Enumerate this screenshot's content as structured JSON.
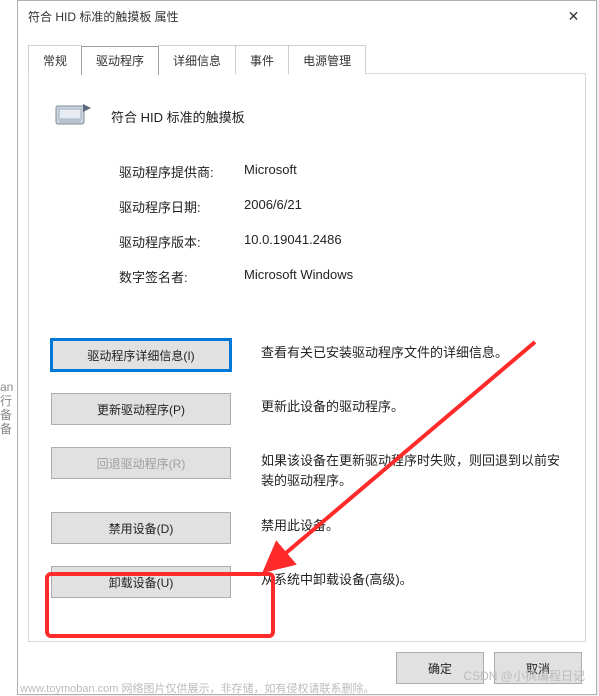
{
  "dialog": {
    "title": "符合 HID 标准的触摸板 属性",
    "close_glyph": "✕"
  },
  "tabs": [
    "常规",
    "驱动程序",
    "详细信息",
    "事件",
    "电源管理"
  ],
  "active_tab_index": 1,
  "device_title": "符合 HID 标准的触摸板",
  "info": {
    "provider_label": "驱动程序提供商:",
    "provider_value": "Microsoft",
    "date_label": "驱动程序日期:",
    "date_value": "2006/6/21",
    "version_label": "驱动程序版本:",
    "version_value": "10.0.19041.2486",
    "signer_label": "数字签名者:",
    "signer_value": "Microsoft Windows"
  },
  "actions": {
    "details_btn": "驱动程序详细信息(I)",
    "details_desc": "查看有关已安装驱动程序文件的详细信息。",
    "update_btn": "更新驱动程序(P)",
    "update_desc": "更新此设备的驱动程序。",
    "rollback_btn": "回退驱动程序(R)",
    "rollback_desc": "如果该设备在更新驱动程序时失败，则回退到以前安装的驱动程序。",
    "disable_btn": "禁用设备(D)",
    "disable_desc": "禁用此设备。",
    "uninstall_btn": "卸载设备(U)",
    "uninstall_desc": "从系统中卸载设备(高级)。"
  },
  "dialog_buttons": {
    "ok": "确定",
    "cancel": "取消"
  },
  "backdrop_text": "an 行 备 备",
  "footer": "www.toymoban.com  网络图片仅供展示，非存储，如有侵权请联系删除。",
  "watermark": "CSDN @小枫编程日记"
}
